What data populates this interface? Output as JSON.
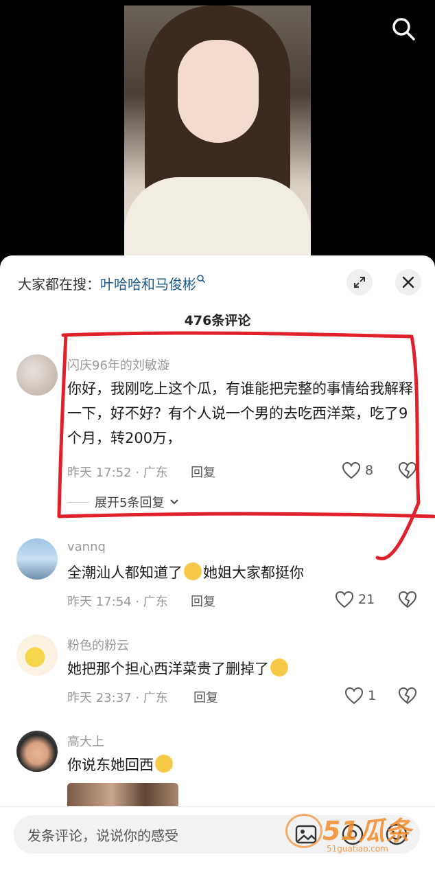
{
  "hot_search": {
    "prefix": "大家都在搜：",
    "term": "叶哈哈和马俊彬"
  },
  "comment_count": "476条评论",
  "comments": [
    {
      "username": "闪庆96年的刘敏漩",
      "text": "你好，我刚吃上这个瓜，有谁能把完整的事情给我解释一下，好不好？有个人说一个男的去吃西洋菜，吃了9个月，转200万，",
      "time_location": "昨天 17:52 · 广东",
      "reply_label": "回复",
      "likes": "8",
      "expand_replies": "展开5条回复"
    },
    {
      "username": "vannq",
      "text_before": "全潮汕人都知道了",
      "text_after": "她姐大家都挺你",
      "time_location": "昨天 17:54 · 广东",
      "reply_label": "回复",
      "likes": "21"
    },
    {
      "username": "粉色的粉云",
      "text_before": "她把那个担心西洋菜贵了删掉了",
      "time_location": "昨天 23:37 · 广东",
      "reply_label": "回复",
      "likes": "1"
    },
    {
      "username": "高大上",
      "text_before": "你说东她回西"
    }
  ],
  "input": {
    "placeholder": "发条评论，说说你的感受"
  },
  "watermark": {
    "brand": "51瓜条",
    "url": "51guatiao.com"
  },
  "colors": {
    "link": "#1f5a8f",
    "annotation": "#e0202a",
    "watermark": "#f48b2c"
  },
  "icons": [
    "search-icon",
    "expand-icon",
    "close-icon",
    "heart-icon",
    "broken-heart-icon",
    "chevron-down-icon",
    "at-icon",
    "emoji-icon",
    "image-icon"
  ]
}
